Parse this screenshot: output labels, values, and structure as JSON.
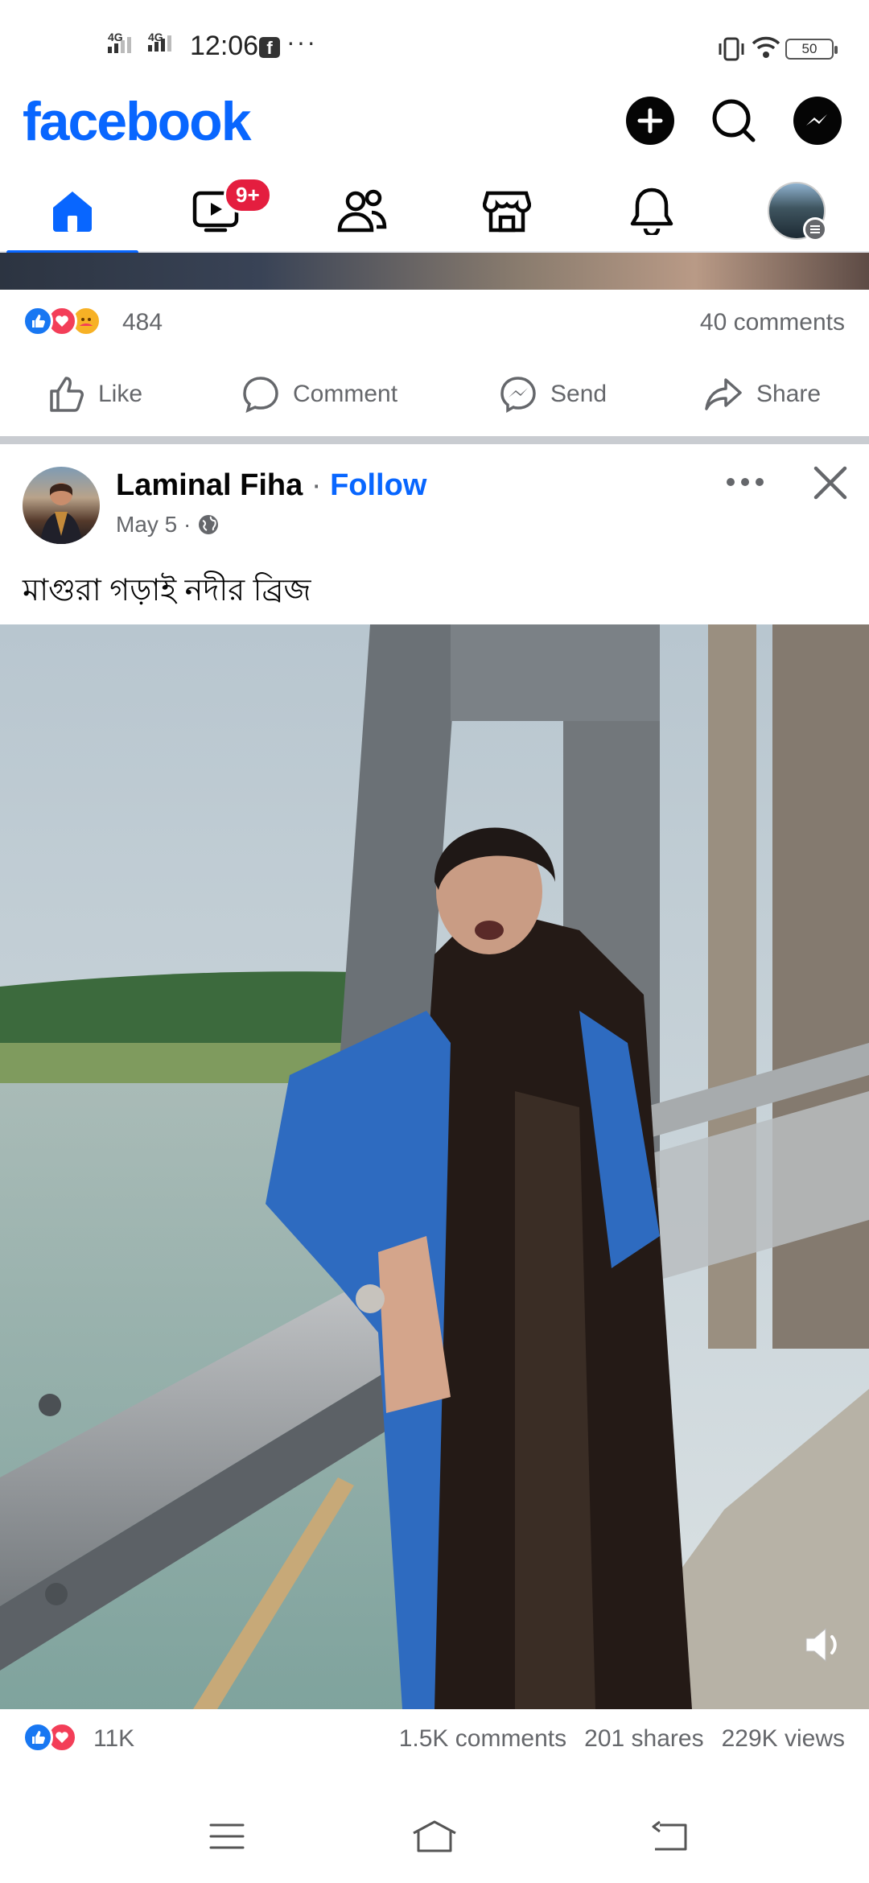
{
  "status_bar": {
    "time": "12:06",
    "network_1": "4G",
    "network_2": "4G",
    "more": "···",
    "battery": "50"
  },
  "header": {
    "logo": "facebook"
  },
  "tabs": {
    "video_badge": "9+"
  },
  "previous_post": {
    "reaction_count": "484",
    "comments": "40 comments"
  },
  "actions": {
    "like": "Like",
    "comment": "Comment",
    "send": "Send",
    "share": "Share"
  },
  "post": {
    "author": "Laminal Fiha",
    "follow_sep": " · ",
    "follow": "Follow",
    "date": "May 5 ·",
    "text": "মাগুরা গড়াই নদীর ব্রিজ",
    "reaction_count": "11K",
    "comments": "1.5K comments",
    "shares": "201 shares",
    "views": "229K views"
  },
  "colors": {
    "brand": "#0866ff",
    "badge": "#e41e3f",
    "secondary_text": "#65676b",
    "love": "#f33e58"
  }
}
